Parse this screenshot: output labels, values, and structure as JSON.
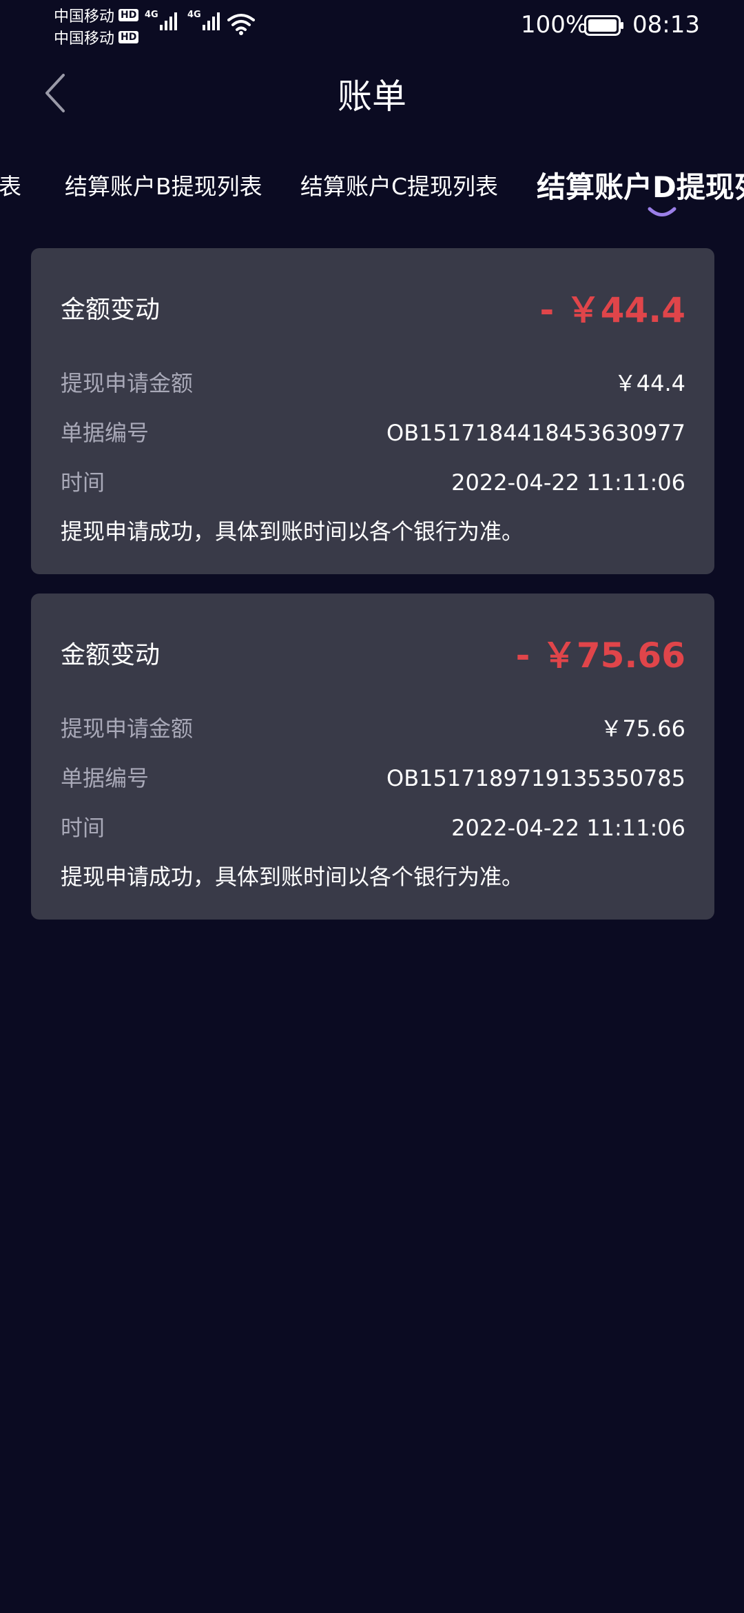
{
  "status_bar": {
    "carrier1": "中国移动",
    "carrier2": "中国移动",
    "hd_badge": "HD",
    "network1": "4G",
    "network2": "4G",
    "battery_percent": "100%",
    "time": "08:13"
  },
  "header": {
    "title": "账单",
    "back_icon": "chevron-left-icon"
  },
  "tabs": [
    {
      "label": "表"
    },
    {
      "label": "结算账户B提现列表"
    },
    {
      "label": "结算账户C提现列表"
    },
    {
      "label": "结算账户D提现列表",
      "active": true
    }
  ],
  "records": [
    {
      "label": "金额变动",
      "amount": "- ￥44.4",
      "apply_amount_label": "提现申请金额",
      "apply_amount": "￥44.4",
      "order_no_label": "单据编号",
      "order_no": "OB1517184418453630977",
      "time_label": "时间",
      "time": "2022-04-22 11:11:06",
      "note": "提现申请成功，具体到账时间以各个银行为准。"
    },
    {
      "label": "金额变动",
      "amount": "- ￥75.66",
      "apply_amount_label": "提现申请金额",
      "apply_amount": "￥75.66",
      "order_no_label": "单据编号",
      "order_no": "OB1517189719135350785",
      "time_label": "时间",
      "time": "2022-04-22 11:11:06",
      "note": "提现申请成功，具体到账时间以各个银行为准。"
    }
  ],
  "colors": {
    "background": "#0b0b22",
    "card": "#393a48",
    "amount_red": "#e0454a",
    "muted_label": "#a9a9b8",
    "tab_indicator": "#9b7fe8"
  }
}
